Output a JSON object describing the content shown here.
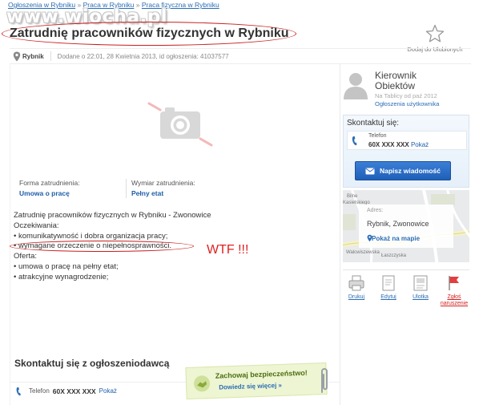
{
  "breadcrumb": {
    "items": [
      "Ogłoszenia w Rybniku",
      "Praca w Rybniku",
      "Praca fizyczna w Rybniku"
    ],
    "separator": "»"
  },
  "watermark": "www.wiocha.pl",
  "ad": {
    "title": "Zatrudnię pracowników fizycznych w Rybniku",
    "city": "Rybnik",
    "meta": "Dodane o 22:01, 28 Kwietnia 2013, id ogłoszenia: 41037577",
    "favorite_label": "Dodaj do Ulubionych"
  },
  "params": [
    {
      "label": "Forma zatrudnienia:",
      "value": "Umowa o pracę"
    },
    {
      "label": "Wymiar zatrudnienia:",
      "value": "Pełny etat"
    }
  ],
  "description": {
    "lines": [
      "Zatrudnię pracowników fizycznych w Rybniku - Zwonowice",
      "Oczekiwania:",
      "• komunikatywność i dobra organizacja pracy;",
      "• wymagane orzeczenie o niepełnosprawności.",
      "Oferta:",
      "• umowa o pracę na pełny etat;",
      "• atrakcyjne wynagrodzenie;"
    ],
    "annotation": "WTF !!!"
  },
  "bottom_contact": {
    "title": "Skontaktuj się z ogłoszeniodawcą",
    "phone_label": "Telefon",
    "phone_number": "60X XXX XXX",
    "show_label": "Pokaż"
  },
  "safety": {
    "title": "Zachowaj bezpieczeństwo!",
    "link": "Dowiedz się więcej »"
  },
  "user": {
    "name": "Kierownik Obiektów",
    "since": "Na Tablicy od paź 2012",
    "ads_link": "Ogłoszenia użytkownika"
  },
  "contact_box": {
    "title": "Skontaktuj się:",
    "phone_label": "Telefon",
    "phone_number": "60X XXX XXX",
    "show_label": "Pokaż",
    "message_button": "Napisz wiadomość"
  },
  "map": {
    "label": "Adres:",
    "city": "Rybnik, Zwonowice",
    "link": "Pokaż na mapie",
    "places": [
      "Bilne",
      "Kasielskiego",
      "Walcwiszewska",
      "Łaszczyska"
    ]
  },
  "actions": [
    {
      "label": "Drukuj",
      "icon": "printer-icon"
    },
    {
      "label": "Edytuj",
      "icon": "edit-icon"
    },
    {
      "label": "Ulotka",
      "icon": "flyer-icon"
    },
    {
      "label": "Zgłoś naruszenie",
      "icon": "flag-icon"
    }
  ],
  "colors": {
    "link": "#1e5eaa",
    "annotation_red": "#c81e1e",
    "button_blue": "#2a6cc7",
    "safety_bg": "#eef5d2"
  }
}
